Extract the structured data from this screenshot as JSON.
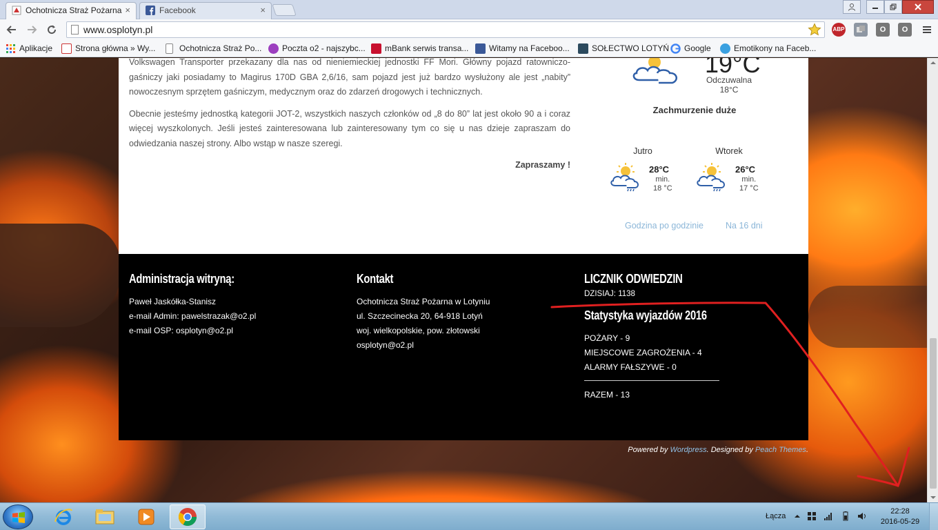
{
  "browser": {
    "tabs": [
      {
        "title": "Ochotnicza Straż Pożarna",
        "active": true
      },
      {
        "title": "Facebook",
        "active": false
      }
    ],
    "close_glyph": "×",
    "url": "www.osplotyn.pl",
    "extensions": {
      "abp": "ABP",
      "e3": "O",
      "e4": "O"
    },
    "bookmarks": [
      {
        "label": "Aplikacje",
        "icon": "apps-grid-icon"
      },
      {
        "label": "Strona główna » Wy...",
        "icon": "site-icon"
      },
      {
        "label": "Ochotnicza Straż Po...",
        "icon": "page-icon"
      },
      {
        "label": "Poczta o2 - najszybc...",
        "icon": "o2-icon"
      },
      {
        "label": "mBank serwis transa...",
        "icon": "mbank-icon"
      },
      {
        "label": "Witamy na Faceboo...",
        "icon": "facebook-icon"
      },
      {
        "label": "SOŁECTWO LOTYŃ",
        "icon": "site-icon"
      },
      {
        "label": "Google",
        "icon": "google-icon"
      },
      {
        "label": "Emotikony na Faceb...",
        "icon": "emoticon-icon"
      }
    ]
  },
  "article": {
    "p1": "Volkswagen Transporter przekazany dla nas od nieniemieckiej jednostki FF Mori. Główny pojazd ratowniczo-gaśniczy jaki posiadamy to Magirus 170D GBA 2,6/16,  sam pojazd jest już bardzo wysłużony ale jest „nabity” nowoczesnym sprzętem gaśniczym, medycznym oraz do zdarzeń drogowych i technicznych.",
    "p2": "Obecnie jesteśmy jednostką kategorii JOT-2, wszystkich naszych członków od „8 do 80” lat jest około 90 a i coraz więcej wyszkolonych. Jeśli jesteś zainteresowana lub zainteresowany tym co się u nas dzieje zapraszam do odwiedzania naszej strony. Albo wstąp w nasze szeregi.",
    "invite": "Zapraszamy !"
  },
  "weather": {
    "current_temp": "19°C",
    "feels_label": "Odczuwalna",
    "feels_value": "18°C",
    "description": "Zachmurzenie duże",
    "days": [
      {
        "name": "Jutro",
        "high": "28°C",
        "min_label": "min.",
        "min": "18 °C"
      },
      {
        "name": "Wtorek",
        "high": "26°C",
        "min_label": "min.",
        "min": "17 °C"
      }
    ],
    "link_hourly": "Godzina po godzinie",
    "link_16days": "Na 16 dni"
  },
  "footer": {
    "admin": {
      "title": "Administracja witryną:",
      "lines": [
        "Paweł Jaskółka-Stanisz",
        "e-mail Admin: pawelstrazak@o2.pl",
        "e-mail OSP: osplotyn@o2.pl"
      ]
    },
    "contact": {
      "title": "Kontakt",
      "lines": [
        "Ochotnicza Straż Pożarna w Lotyniu",
        "ul. Szczecinecka 20, 64-918 Lotyń",
        "woj. wielkopolskie, pow. złotowski",
        "osplotyn@o2.pl"
      ]
    },
    "counter": {
      "title": "LICZNIK ODWIEDZIN",
      "today": "DZISIAJ: 1138"
    },
    "stats": {
      "title": "Statystyka wyjazdów 2016",
      "lines": [
        "POŻARY - 9",
        "MIEJSCOWE ZAGROŻENIA - 4",
        "ALARMY FAŁSZYWE - 0"
      ],
      "total": "RAZEM - 13"
    }
  },
  "credits": {
    "powered": "Powered by",
    "wordpress": "Wordpress",
    "designed": ". Designed by",
    "theme": "Peach Themes",
    "end": "."
  },
  "taskbar": {
    "lang_label": "Łącza",
    "time": "22:28",
    "date": "2016-05-29"
  },
  "colors": {
    "link_blue": "#8bb6d8",
    "annotation_red": "#e02020",
    "footer_bg": "#000000"
  }
}
